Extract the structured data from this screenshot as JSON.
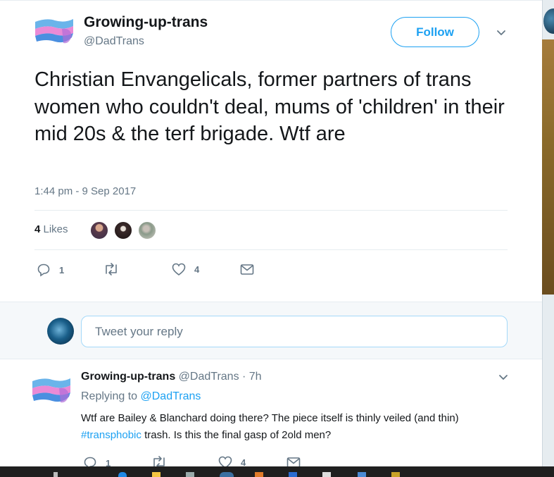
{
  "tweet": {
    "author_name": "Growing-up-trans",
    "author_handle": "@DadTrans",
    "follow_label": "Follow",
    "text": "Christian Envangelicals, former partners of trans women who couldn't deal, mums of 'children' in their mid 20s & the terf brigade. Wtf are",
    "timestamp": "1:44 pm - 9 Sep 2017",
    "likes_number": "4",
    "likes_word": " Likes",
    "actions": {
      "reply_count": "1",
      "retweet_count": "",
      "like_count": "4"
    }
  },
  "reply_box": {
    "placeholder": "Tweet your reply"
  },
  "reply": {
    "author_name": "Growing-up-trans",
    "meta": " @DadTrans · 7h",
    "replying_prefix": "Replying to ",
    "replying_handle": "@DadTrans",
    "text_before": "Wtf are Bailey & Blanchard doing there? The piece itself is thinly veiled (and thin) ",
    "hashtag": "#transphobic",
    "text_after": " trash. Is this the final gasp of 2old men?",
    "reply_count": "1",
    "like_count": "4"
  },
  "colors": {
    "accent": "#1da1f2",
    "text": "#14171a",
    "secondary": "#657786",
    "flag_blue": "#4fa3e0",
    "flag_pink": "#e98ad6"
  },
  "icons": [
    "flag-avatar-icon",
    "chevron-down-icon",
    "reply-icon",
    "retweet-icon",
    "heart-icon",
    "envelope-icon"
  ]
}
